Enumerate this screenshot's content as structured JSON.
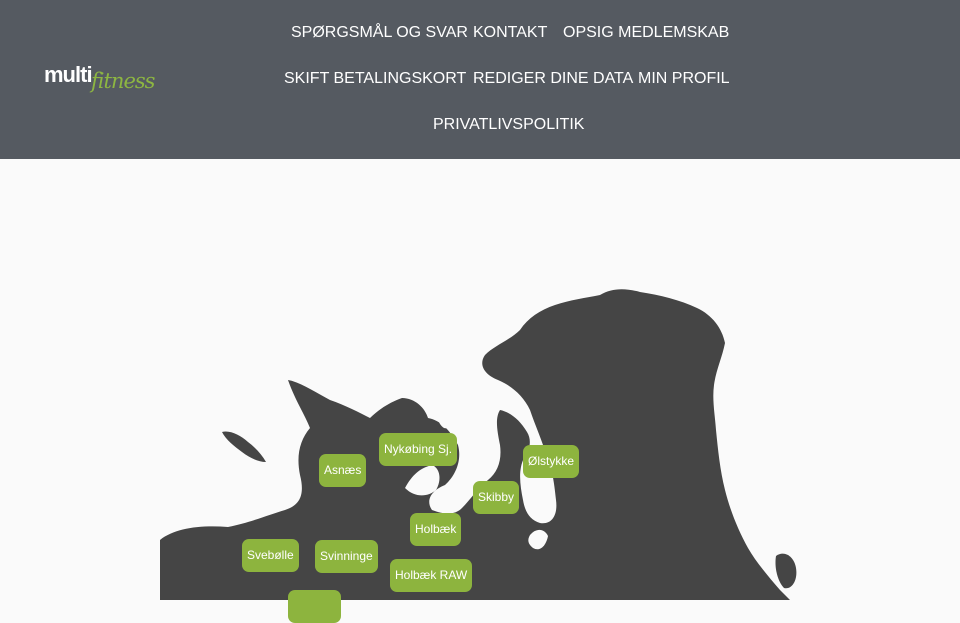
{
  "header": {
    "logo": {
      "word1": "multi",
      "word2": "fitness"
    },
    "nav": [
      {
        "label": "SPØRGSMÅL OG SVAR"
      },
      {
        "label": "KONTAKT"
      },
      {
        "label": "OPSIG MEDLEMSKAB"
      },
      {
        "label": "SKIFT BETALINGSKORT"
      },
      {
        "label": "REDIGER DINE DATA"
      },
      {
        "label": "MIN PROFIL"
      },
      {
        "label": "PRIVATLIVSPOLITIK"
      }
    ]
  },
  "map": {
    "pins": [
      {
        "label": "Asnæs"
      },
      {
        "label": "Nykøbing Sj."
      },
      {
        "label": "Ølstykke"
      },
      {
        "label": "Skibby"
      },
      {
        "label": "Holbæk"
      },
      {
        "label": "Svebølle"
      },
      {
        "label": "Svinninge"
      },
      {
        "label": "Holbæk RAW"
      },
      {
        "label": ""
      }
    ]
  },
  "colors": {
    "header": "#555a61",
    "land": "#454545",
    "pin": "#8db43e",
    "background": "#fafafa"
  }
}
